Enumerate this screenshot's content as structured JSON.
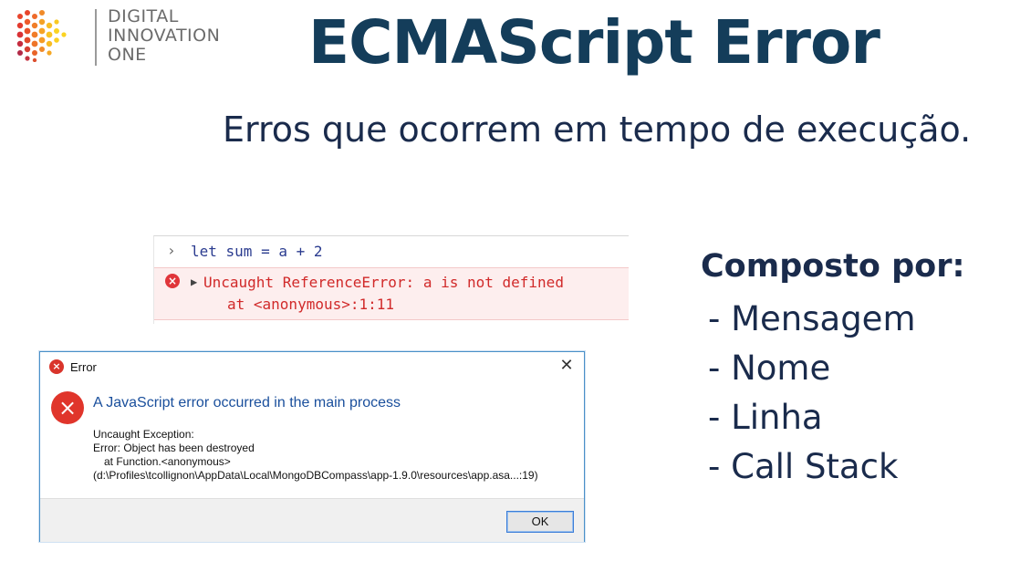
{
  "logo": {
    "line1": "DIGITAL",
    "line2": "INNOVATION",
    "line3": "ONE"
  },
  "title": "ECMAScript Error",
  "subtitle": "Erros que ocorrem em tempo de execução.",
  "console": {
    "input": "let sum = a + 2",
    "error_line1": "Uncaught ReferenceError: a is not defined",
    "error_line2": "at <anonymous>:1:11",
    "colors": {
      "error_bg": "#fdeeee",
      "error_text": "#d12a2a",
      "input_text": "#2a3b8f"
    }
  },
  "dialog": {
    "title": "Error",
    "heading": "A JavaScript error occurred in the main process",
    "body": [
      "Uncaught Exception:",
      "Error: Object has been destroyed",
      "at Function.<anonymous>",
      "(d:\\Profiles\\tcollignon\\AppData\\Local\\MongoDBCompass\\app-1.9.0\\resources\\app.asa...:19)"
    ],
    "ok_label": "OK",
    "icons": {
      "title": "error-icon",
      "close": "close-icon",
      "big": "error-icon"
    }
  },
  "composition": {
    "heading": "Composto por:",
    "items": [
      "- Mensagem",
      "- Nome",
      "- Linha",
      "- Call Stack"
    ]
  },
  "colors": {
    "title": "#143d5a",
    "text": "#1a2b4c",
    "dialog_heading": "#1a4f9c"
  }
}
